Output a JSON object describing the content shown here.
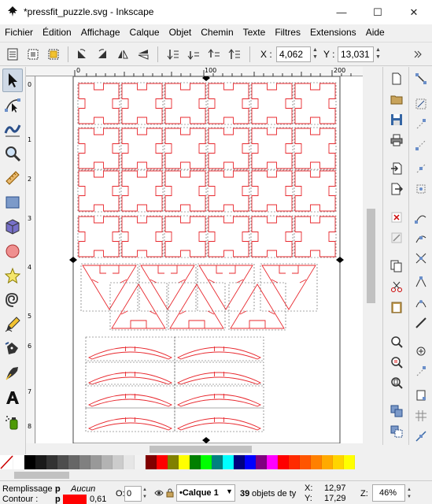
{
  "window": {
    "title": "*pressfit_puzzle.svg - Inkscape",
    "minimize_glyph": "—",
    "maximize_glyph": "☐",
    "close_glyph": "✕"
  },
  "menu": [
    {
      "label": "Fichier"
    },
    {
      "label": "Édition"
    },
    {
      "label": "Affichage"
    },
    {
      "label": "Calque"
    },
    {
      "label": "Objet"
    },
    {
      "label": "Chemin"
    },
    {
      "label": "Texte"
    },
    {
      "label": "Filtres"
    },
    {
      "label": "Extensions"
    },
    {
      "label": "Aide"
    }
  ],
  "toolctrl": {
    "x_label": "X :",
    "x_value": "4,062",
    "y_label": "Y :",
    "y_value": "13,031"
  },
  "ruler": {
    "top_labels": [
      "0",
      "100",
      "200"
    ],
    "left_labels": [
      "0",
      "1",
      "2",
      "3",
      "4",
      "5",
      "6",
      "7",
      "8"
    ]
  },
  "palette": {
    "colors": [
      "#ffffff",
      "#000000",
      "#1a1a1a",
      "#333333",
      "#4d4d4d",
      "#666666",
      "#808080",
      "#999999",
      "#b3b3b3",
      "#cccccc",
      "#e6e6e6",
      "#f2f2f2",
      "#800000",
      "#ff0000",
      "#808000",
      "#ffff00",
      "#008000",
      "#00ff00",
      "#008080",
      "#00ffff",
      "#000080",
      "#0000ff",
      "#800080",
      "#ff00ff",
      "#ff0000",
      "#ff2a00",
      "#ff5500",
      "#ff8000",
      "#ffaa00",
      "#ffd400",
      "#ffff00"
    ]
  },
  "status": {
    "fill_label": "Remplissage :",
    "fill_value": "p",
    "fill_state": "Aucun",
    "stroke_label": "Contour :",
    "stroke_value": "p",
    "stroke_color": "#ff0000",
    "stroke_width": "0,61",
    "opacity_label": "O:",
    "opacity_value": "0",
    "layer": "•Calque 1",
    "message_count": "39",
    "message_rest": " objets de ty",
    "x_label": "X:",
    "x_value": "12,97",
    "y_label": "Y:",
    "y_value": "17,29",
    "zoom_label": "Z:",
    "zoom_value": "46%"
  },
  "colors": {
    "path": "#e8282e",
    "bbox": "#555555"
  }
}
